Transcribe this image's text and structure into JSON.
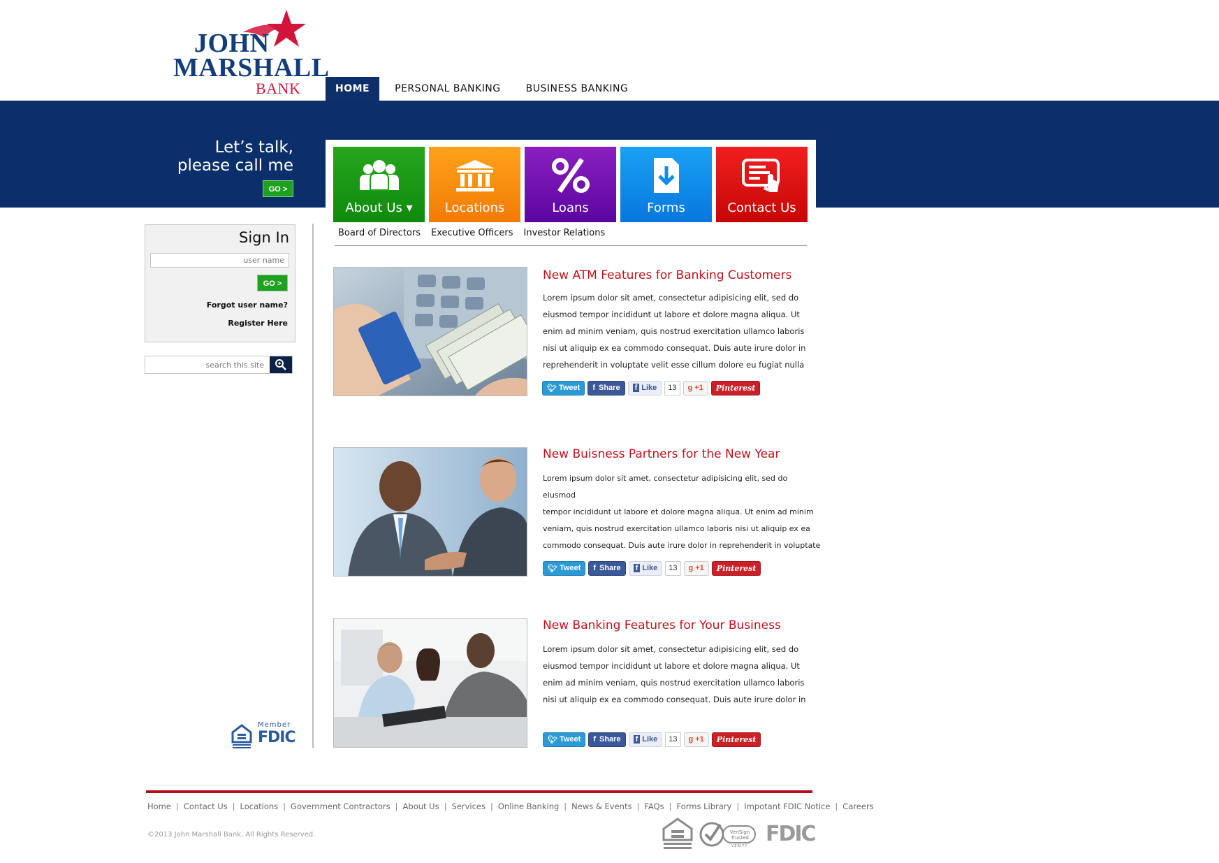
{
  "brand": {
    "logo_line1": "JOHN",
    "logo_line2": "MARSHALL",
    "logo_line3": "BANK"
  },
  "topnav": [
    {
      "label": "HOME",
      "active": true
    },
    {
      "label": "PERSONAL BANKING",
      "active": false
    },
    {
      "label": "BUSINESS BANKING",
      "active": false
    }
  ],
  "callme": {
    "line1": "Let’s talk,",
    "line2": "please call me",
    "go_label": "GO >"
  },
  "tiles": [
    {
      "label": "About Us ▾",
      "icon": "people-icon",
      "color": "#1e9e18"
    },
    {
      "label": "Locations",
      "icon": "bank-building-icon",
      "color": "#f98d0e"
    },
    {
      "label": "Loans",
      "icon": "percent-icon",
      "color": "#7314b2"
    },
    {
      "label": "Forms",
      "icon": "document-download-icon",
      "color": "#0e8cec"
    },
    {
      "label": "Contact Us",
      "icon": "form-pointer-icon",
      "color": "#de1010"
    }
  ],
  "subnav": [
    "Board of Directors",
    "Executive Officers",
    "Investor Relations"
  ],
  "signin": {
    "title": "Sign In",
    "username_placeholder": "user name",
    "go_label": "GO >",
    "forgot": "Forgot user name?",
    "register": "Register Here"
  },
  "search": {
    "placeholder": "search this site"
  },
  "fdic_left": {
    "member": "Member",
    "fdic": "FDIC",
    "ehl": "EQUAL HOUSING LENDER"
  },
  "articles": [
    {
      "title": "New ATM Features for Banking Customers",
      "lines": [
        "Lorem ipsum dolor sit amet, consectetur adipisicing elit, sed do",
        "eiusmod tempor incididunt ut labore et dolore magna aliqua. Ut",
        "enim ad minim veniam, quis nostrud exercitation ullamco laboris",
        "nisi ut aliquip ex ea commodo consequat. Duis aute irure dolor in",
        "reprehenderit in voluptate velit esse cillum dolore eu fugiat nulla"
      ],
      "image": "atm-cash-photo"
    },
    {
      "title": "New Buisness Partners for the New Year",
      "lines": [
        "Lorem ipsum dolor sit amet, consectetur adipisicing elit, sed do eiusmod",
        "tempor incididunt ut labore et dolore magna aliqua. Ut enim ad minim",
        "veniam, quis nostrud exercitation ullamco laboris nisi ut aliquip ex ea",
        "commodo consequat. Duis aute irure dolor in reprehenderit in voluptate"
      ],
      "image": "handshake-photo"
    },
    {
      "title": "New Banking Features for Your Business",
      "lines": [
        "Lorem ipsum dolor sit amet, consectetur adipisicing elit, sed do",
        "eiusmod tempor incididunt ut labore et dolore magna aliqua. Ut",
        "enim ad minim veniam, quis nostrud exercitation ullamco laboris",
        "nisi ut aliquip ex ea commodo consequat. Duis aute irure dolor in"
      ],
      "image": "couple-meeting-photo"
    }
  ],
  "social": {
    "tweet": "Tweet",
    "share": "Share",
    "like": "Like",
    "like_count": "13",
    "plus": "+1",
    "pinterest": "Pinterest"
  },
  "footer": {
    "links": [
      "Home",
      "Contact Us",
      "Locations",
      "Government Contractors",
      "About Us",
      "Services",
      "Online Banking",
      "News & Events",
      "FAQs",
      "Forms Library",
      "Impotant FDIC Notice",
      "Careers"
    ],
    "copyright": "©2013 John Marshall Bank, All Rights Reserved.",
    "verisign": "VeriSign Trusted",
    "verify": "VERIFY",
    "fdic": "FDIC"
  },
  "colors": {
    "navy": "#0b2f6b",
    "accent_red": "#c0111a",
    "go_green": "#1ea11e"
  }
}
